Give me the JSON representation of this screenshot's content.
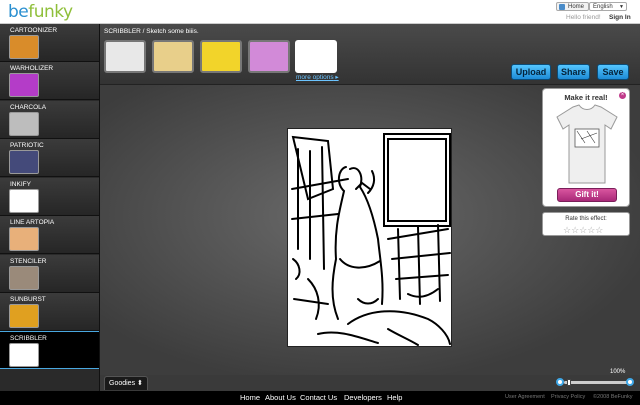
{
  "header": {
    "logo_text": "be",
    "logo_text2": "funky",
    "home_label": "Home",
    "language": "English",
    "greeting": "Hello friend!",
    "sign_in": "Sign In"
  },
  "sidebar": {
    "items": [
      {
        "label": "CARTOONIZER",
        "thumb": "#d98c2a"
      },
      {
        "label": "WARHOLIZER",
        "thumb": "#b43cc8"
      },
      {
        "label": "CHARCOLA",
        "thumb": "#bdbdbd"
      },
      {
        "label": "PATRIOTIC",
        "thumb": "#444a7a"
      },
      {
        "label": "INKIFY",
        "thumb": "#ffffff"
      },
      {
        "label": "LINE ARTOPIA",
        "thumb": "#e8b07a"
      },
      {
        "label": "STENCILER",
        "thumb": "#9a8a7a"
      },
      {
        "label": "SUNBURST",
        "thumb": "#e0a020"
      },
      {
        "label": "SCRIBBLER",
        "thumb": "#ffffff"
      }
    ],
    "active_index": 8
  },
  "toolbar": {
    "title": "SCRIBBLER / Sketch some biiis.",
    "variants": [
      "#e8e8e8",
      "#e8cf8a",
      "#f2d42a",
      "#d28ad8",
      "#ffffff"
    ],
    "more_options": "more options",
    "upload": "Upload",
    "share": "Share",
    "save": "Save"
  },
  "shirt": {
    "title": "Make it real!",
    "gift": "Gift it!",
    "rate": "Rate this effect:",
    "stars": "☆☆☆☆☆"
  },
  "canvas": {
    "goodies": "Goodies",
    "zoom": "100%",
    "zoom_level": 0.05
  },
  "footer": {
    "nav": [
      "Home",
      "About Us",
      "Contact Us",
      "Developers",
      "Help"
    ],
    "links": [
      "User Agreement",
      "Privacy Policy",
      "©2008 BeFunky"
    ]
  },
  "colors": {
    "accent_blue": "#2a9be0",
    "gift_pink": "#c03a8a"
  }
}
